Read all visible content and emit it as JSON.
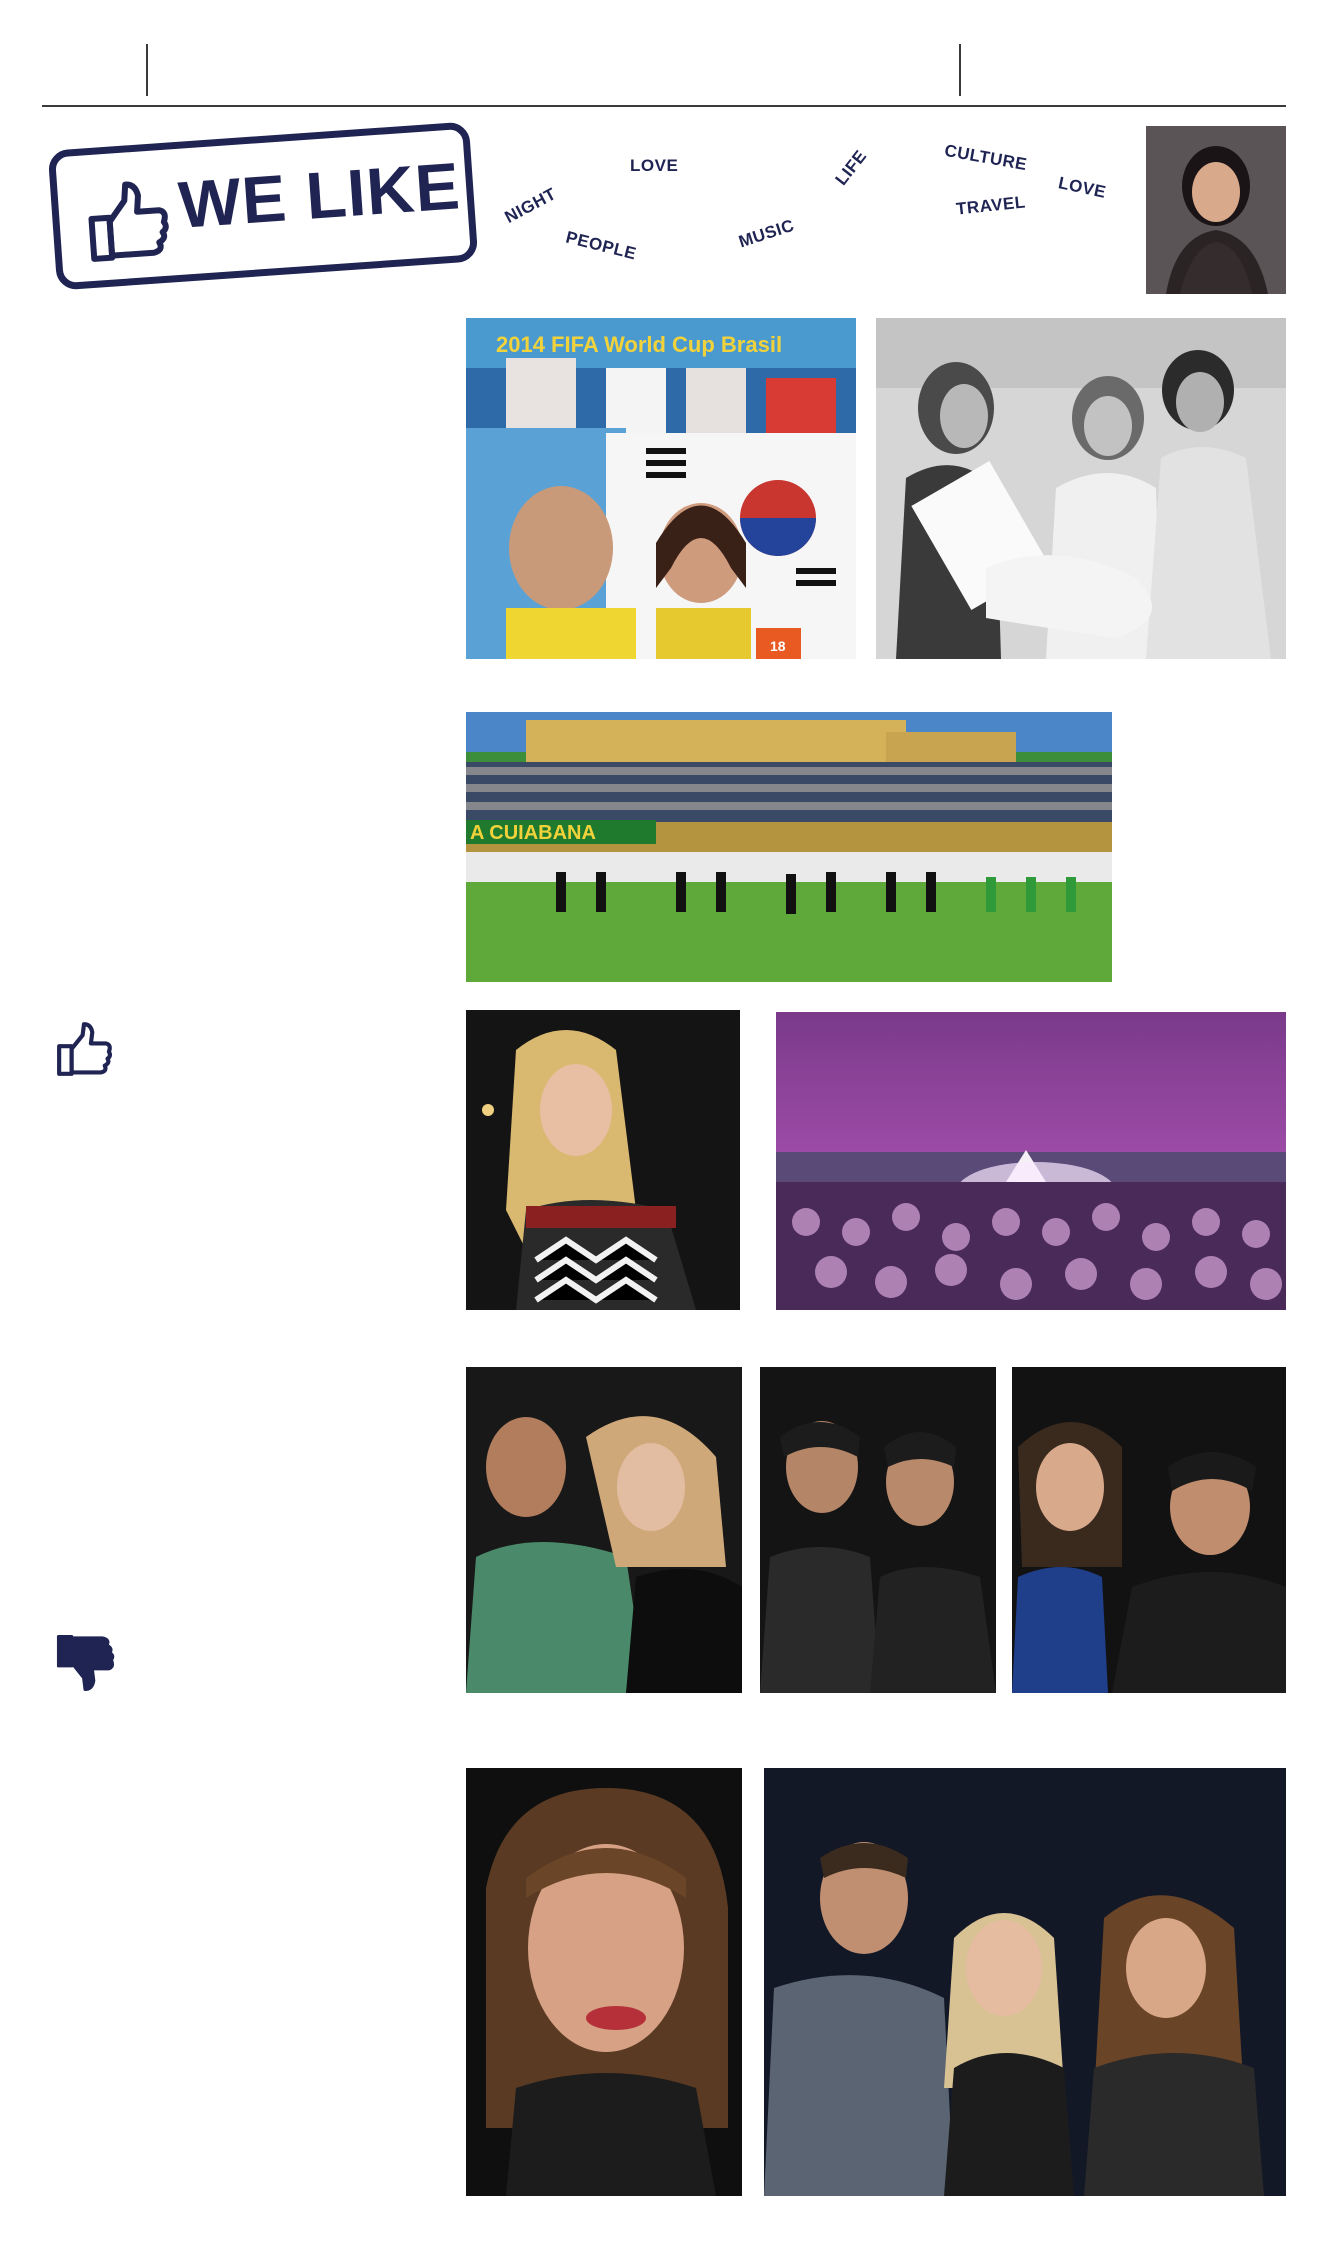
{
  "header": {
    "stamp_text": "WE LIKE"
  },
  "tag_words": [
    "NIGHT",
    "LOVE",
    "PEOPLE",
    "MUSIC",
    "LIFE",
    "CULTURE",
    "TRAVEL",
    "LOVE"
  ],
  "photos": {
    "stadium_banner_text": "A CUIABANA",
    "worldcup_banner_text": "2014 FIFA World Cup Brasil",
    "jersey_number": "18"
  },
  "colors": {
    "brand_navy": "#1f2453",
    "rule": "#3a3a3a"
  },
  "icons": {
    "like": "thumbs-up-icon",
    "dislike": "thumbs-down-icon"
  }
}
